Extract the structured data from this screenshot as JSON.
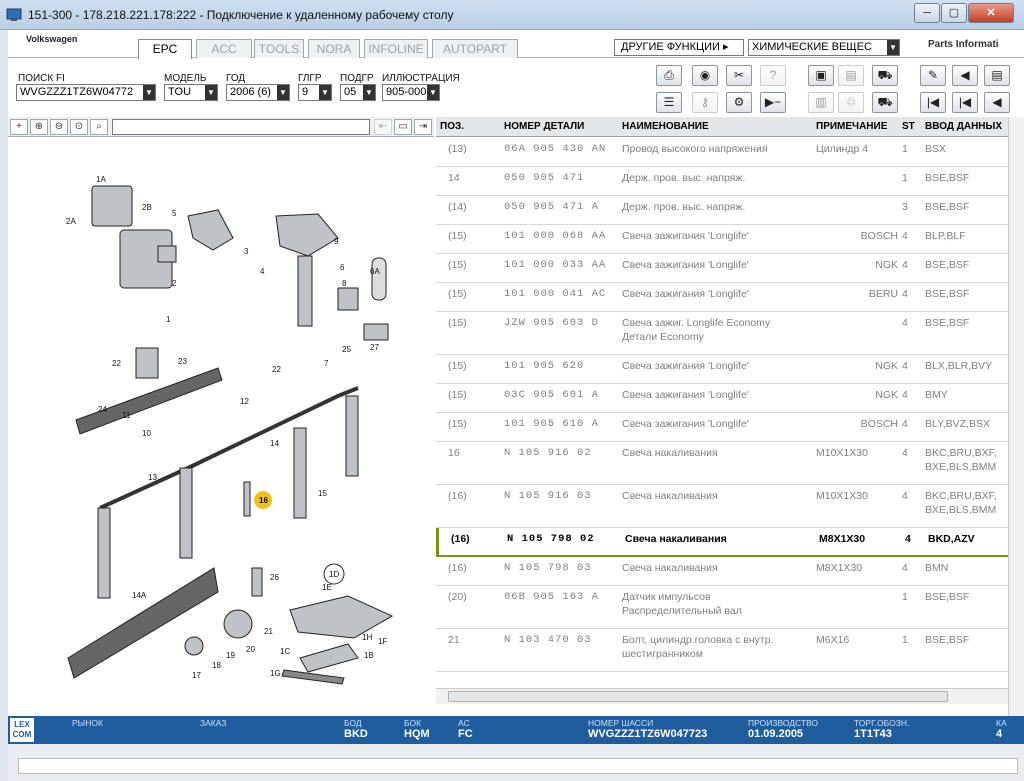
{
  "window": {
    "title": "151-300 - 178.218.221.178:222 - Подключение к удаленному рабочему столу",
    "minimize": "─",
    "restore": "▢",
    "close": "✕"
  },
  "app": {
    "brand": "Volkswagen",
    "brand_right": "Parts Informati",
    "tabs": [
      "EPC",
      "ACC",
      "TOOLS",
      "NORA",
      "INFOLINE",
      "AUTOPART"
    ],
    "other_functions": "ДРУГИЕ ФУНКЦИИ ▸",
    "chemicals": "ХИМИЧЕСКИЕ ВЕЩЕС"
  },
  "filters": {
    "search_fi": {
      "label": "ПОИСК FI",
      "value": "WVGZZZ1TZ6W04772"
    },
    "model": {
      "label": "МОДЕЛЬ",
      "value": "TOU"
    },
    "year": {
      "label": "ГОД",
      "value": "2006 (6)"
    },
    "group": {
      "label": "ГЛГР",
      "value": "9"
    },
    "subgroup": {
      "label": "ПОДГР",
      "value": "05"
    },
    "illustration": {
      "label": "ИЛЛЮСТРАЦИЯ",
      "value": "905-000"
    }
  },
  "grid": {
    "headers": {
      "pos": "ПОЗ.",
      "part": "НОМЕР ДЕТАЛИ",
      "name": "НАИМЕНОВАНИЕ",
      "note": "ПРИМЕЧАНИЕ",
      "st": "ST",
      "entry": "ВВОД ДАННЫХ"
    },
    "rows": [
      {
        "pos": "(13)",
        "part": "06A 905 430 AN",
        "name": "Провод высокого напряжения",
        "note": "Цилиндр 4",
        "st": "1",
        "entry": "BSX"
      },
      {
        "pos": "14",
        "part": "050 905 471",
        "name": "Держ. пров. выс. напряж.",
        "note": "",
        "st": "1",
        "entry": "BSE,BSF"
      },
      {
        "pos": "(14)",
        "part": "050 905 471 A",
        "name": "Держ. пров. выс. напряж.",
        "note": "",
        "st": "3",
        "entry": "BSE,BSF"
      },
      {
        "pos": "(15)",
        "part": "101 000 068 AA",
        "name": "Свеча зажигания 'Longlife'",
        "note": "BOSCH",
        "st": "4",
        "entry": "BLP,BLF"
      },
      {
        "pos": "(15)",
        "part": "101 000 033 AA",
        "name": "Свеча зажигания 'Longlife'",
        "note": "NGK",
        "st": "4",
        "entry": "BSE,BSF"
      },
      {
        "pos": "(15)",
        "part": "101 000 041 AC",
        "name": "Свеча зажигания 'Longlife'",
        "note": "BERU",
        "st": "4",
        "entry": "BSE,BSF"
      },
      {
        "pos": "(15)",
        "part": "JZW 905 603 D",
        "name": "Свеча зажиг. Longlife Economy Детали Economy",
        "note": "",
        "st": "4",
        "entry": "BSE,BSF"
      },
      {
        "pos": "(15)",
        "part": "101 905 620",
        "name": "Свеча зажигания 'Longlife'",
        "note": "NGK",
        "st": "4",
        "entry": "BLX,BLR,BVY"
      },
      {
        "pos": "(15)",
        "part": "03C 905 601 A",
        "name": "Свеча зажигания 'Longlife'",
        "note": "NGK",
        "st": "4",
        "entry": "BMY"
      },
      {
        "pos": "(15)",
        "part": "101 905 610 A",
        "name": "Свеча зажигания 'Longlife'",
        "note": "BOSCH",
        "st": "4",
        "entry": "BLY,BVZ,BSX"
      },
      {
        "pos": "16",
        "part": "N 105 916 02",
        "name": "Свеча накаливания",
        "note": "M10X1X30",
        "st": "4",
        "entry": "BKC,BRU,BXF, BXE,BLS,BMM"
      },
      {
        "pos": "(16)",
        "part": "N 105 916 03",
        "name": "Свеча накаливания",
        "note": "M10X1X30",
        "st": "4",
        "entry": "BKC,BRU,BXF, BXE,BLS,BMM"
      },
      {
        "pos": "(16)",
        "part": "N 105 798 02",
        "name": "Свеча накаливания",
        "note": "M8X1X30",
        "st": "4",
        "entry": "BKD,AZV",
        "selected": true
      },
      {
        "pos": "(16)",
        "part": "N 105 798 03",
        "name": "Свеча накаливания",
        "note": "M8X1X30",
        "st": "4",
        "entry": "BMN"
      },
      {
        "pos": "(20)",
        "part": "06B 905 163 A",
        "name": "Датчик импульсов Распределительный вал",
        "note": "",
        "st": "1",
        "entry": "BSE,BSF"
      },
      {
        "pos": "21",
        "part": "N 103 470 03",
        "name": "Болт, цилиндр.головка с внутр. шестигранником",
        "note": "M6X16",
        "st": "1",
        "entry": "BSE,BSF"
      }
    ]
  },
  "status": {
    "lexcom": "LEX COM",
    "market": {
      "label": "РЫНОК",
      "value": ""
    },
    "order": {
      "label": "ЗАКАЗ",
      "value": ""
    },
    "bod": {
      "label": "БОД",
      "value": "BKD"
    },
    "bok": {
      "label": "БОК",
      "value": "HQM"
    },
    "ac": {
      "label": "AC",
      "value": "FC"
    },
    "chassis": {
      "label": "НОМЕР ШАССИ",
      "value": "WVGZZZ1TZ6W047723"
    },
    "production": {
      "label": "ПРОИЗВОДСТВО",
      "value": "01.09.2005"
    },
    "trade": {
      "label": "ТОРГ.ОБОЗН.",
      "value": "1T1T43"
    },
    "ka": {
      "label": "КА",
      "value": "4"
    }
  },
  "diagram_labels": [
    "1A",
    "2A",
    "2B",
    "5",
    "9",
    "6",
    "4",
    "3",
    "8",
    "6A",
    "1",
    "2",
    "23",
    "22",
    "25",
    "27",
    "7",
    "22",
    "24",
    "11",
    "10",
    "12",
    "14",
    "13",
    "16",
    "15",
    "1D",
    "1E",
    "26",
    "14A",
    "21",
    "20",
    "19",
    "18",
    "17",
    "1H",
    "1F",
    "1C",
    "1B",
    "1G"
  ]
}
